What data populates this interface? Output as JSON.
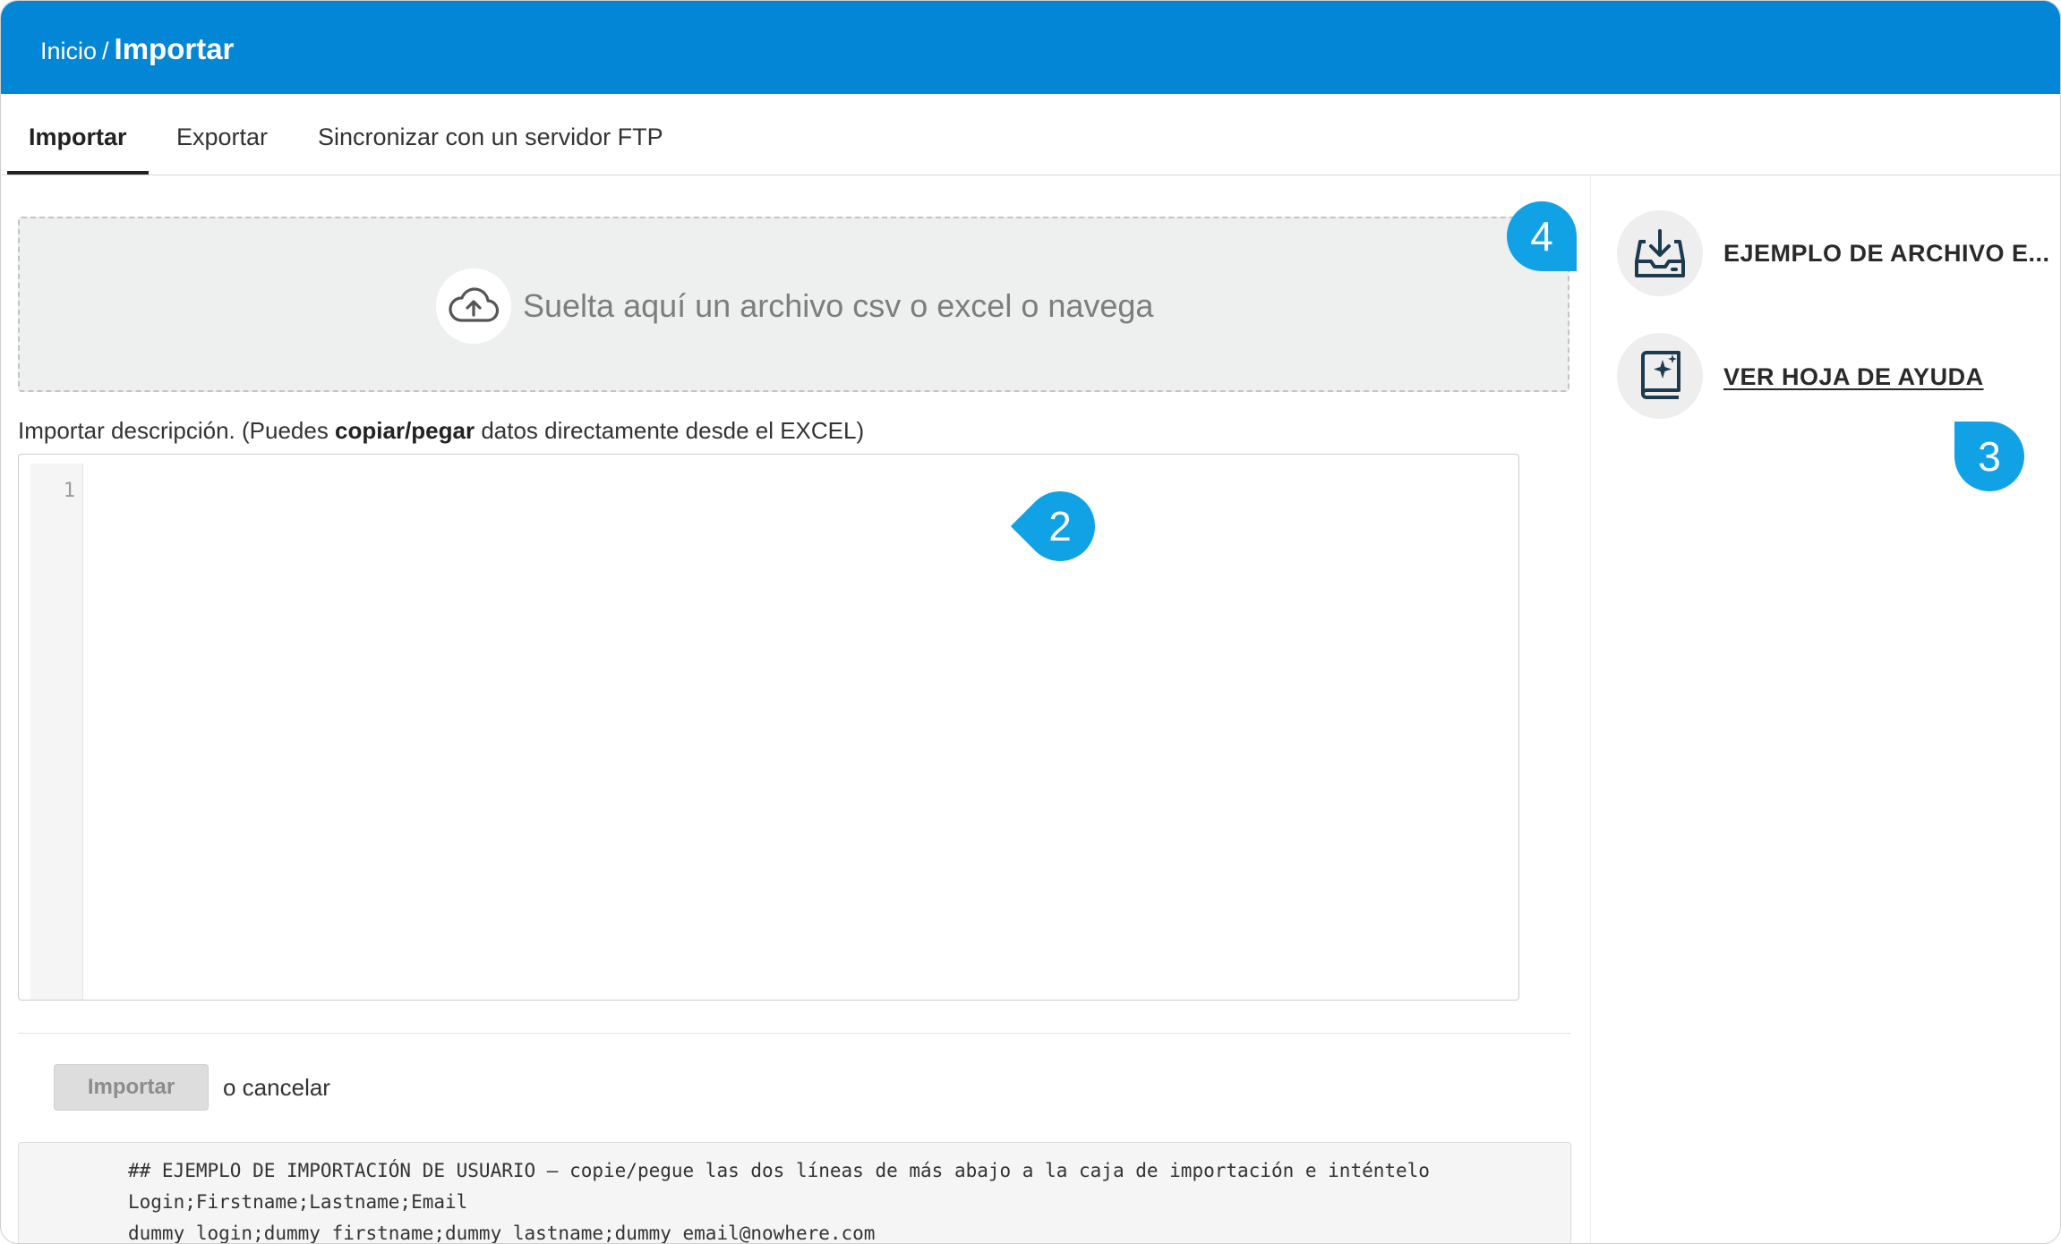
{
  "breadcrumb": {
    "parent": "Inicio",
    "separator": "/",
    "current": "Importar"
  },
  "tabs": [
    {
      "label": "Importar",
      "active": true
    },
    {
      "label": "Exportar",
      "active": false
    },
    {
      "label": "Sincronizar con un servidor FTP",
      "active": false
    }
  ],
  "dropzone": {
    "text": "Suelta aquí un archivo csv o excel o navega",
    "icon": "cloud-upload-icon"
  },
  "description": {
    "prefix": "Importar descripción. (Puedes ",
    "bold": "copiar/pegar",
    "suffix": " datos directamente desde el EXCEL)"
  },
  "editor": {
    "line_number": "1",
    "value": ""
  },
  "actions": {
    "import_label": "Importar",
    "cancel_text": "o cancelar"
  },
  "example": {
    "lines": [
      "## EJEMPLO DE IMPORTACIÓN DE USUARIO – copie/pegue las dos líneas de más abajo a la caja de importación e inténtelo",
      "Login;Firstname;Lastname;Email",
      "dummy_login;dummy_firstname;dummy_lastname;dummy_email@nowhere.com"
    ]
  },
  "sidebar": {
    "download_example": {
      "label": "EJEMPLO DE ARCHIVO E...",
      "icon": "tray-download-icon"
    },
    "help_sheet": {
      "label": "VER HOJA DE AYUDA",
      "icon": "book-sparkle-icon"
    }
  },
  "callouts": [
    "2",
    "3",
    "4"
  ],
  "colors": {
    "header": "#0386d6",
    "callout": "#11a2e6",
    "icon_stroke": "#1d3a4f"
  }
}
